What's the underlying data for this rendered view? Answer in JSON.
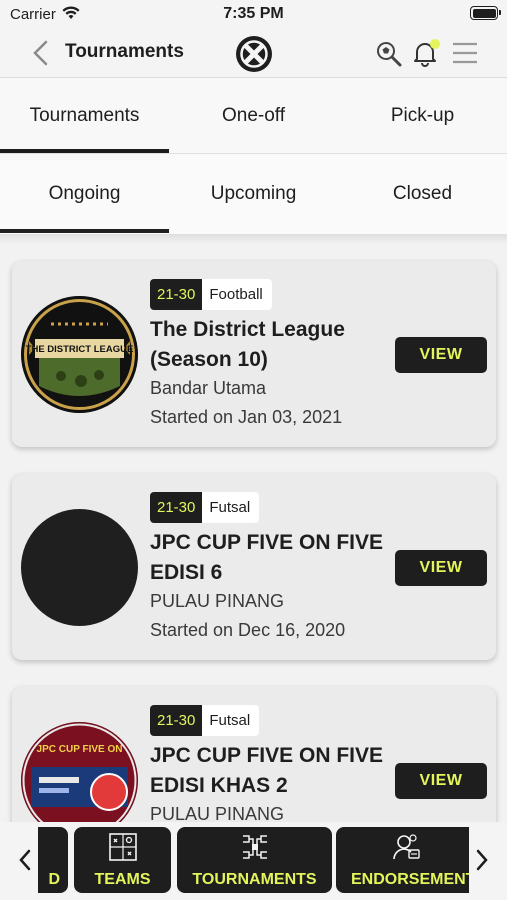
{
  "status_bar": {
    "carrier": "Carrier",
    "time": "7:35 PM"
  },
  "nav": {
    "title": "Tournaments"
  },
  "primary_tabs": [
    "Tournaments",
    "One-off",
    "Pick-up"
  ],
  "secondary_tabs": [
    "Ongoing",
    "Upcoming",
    "Closed"
  ],
  "cards": [
    {
      "age": "21-30",
      "sport": "Football",
      "title": "The District League (Season 10)",
      "location": "Bandar Utama",
      "date": "Started on Jan 03, 2021",
      "view_label": "VIEW"
    },
    {
      "age": "21-30",
      "sport": "Futsal",
      "title": "JPC CUP FIVE ON FIVE EDISI 6",
      "location": "PULAU PINANG",
      "date": "Started on Dec 16, 2020",
      "view_label": "VIEW"
    },
    {
      "age": "21-30",
      "sport": "Futsal",
      "title": "JPC CUP FIVE ON FIVE EDISI KHAS 2",
      "location": "PULAU PINANG",
      "date": "",
      "view_label": "VIEW"
    }
  ],
  "logo_text": {
    "league": "THE DISTRICT LEAGUE",
    "jpc": "JPC CUP FIVE ON"
  },
  "bottom_nav": [
    {
      "label": "D",
      "icon": "partial-icon"
    },
    {
      "label": "TEAMS",
      "icon": "teams-icon"
    },
    {
      "label": "TOURNAMENTS",
      "icon": "bracket-icon"
    },
    {
      "label": "ENDORSEMENT",
      "icon": "endorsement-icon"
    }
  ],
  "colors": {
    "accent": "#e3f55b",
    "dark": "#1e1e1e",
    "card": "#ebebeb"
  }
}
